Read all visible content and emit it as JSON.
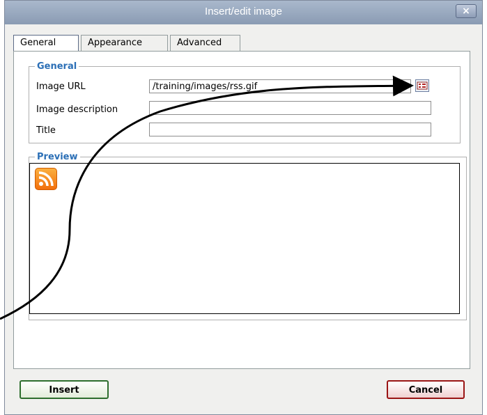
{
  "dialog": {
    "title": "Insert/edit image",
    "close_label": "×"
  },
  "tabs": [
    {
      "label": "General",
      "active": true
    },
    {
      "label": "Appearance",
      "active": false
    },
    {
      "label": "Advanced",
      "active": false
    }
  ],
  "general": {
    "legend": "General",
    "image_url_label": "Image URL",
    "image_url_value": "/training/images/rss.gif",
    "description_label": "Image description",
    "description_value": "",
    "title_label": "Title",
    "title_value": ""
  },
  "preview": {
    "legend": "Preview"
  },
  "buttons": {
    "insert": "Insert",
    "cancel": "Cancel"
  },
  "icons": {
    "browse": "browse-icon",
    "rss": "rss-icon",
    "annotation_arrow": "arrow-icon"
  },
  "colors": {
    "titlebar": "#9aaac0",
    "legend": "#2b6fb6",
    "insert_border": "#2d6e2d",
    "cancel_border": "#9a1414",
    "rss": "#f7941d"
  }
}
